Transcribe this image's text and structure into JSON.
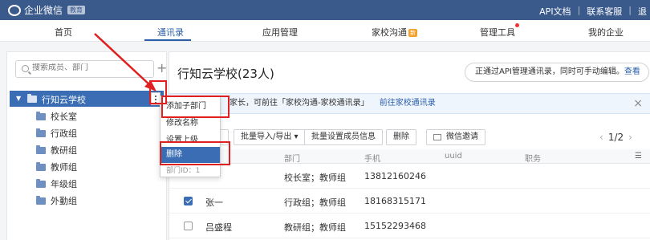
{
  "topbar": {
    "logo_text": "企业微信",
    "logo_badge": "教育",
    "links": [
      "API文档",
      "联系客服",
      "退"
    ]
  },
  "nav": {
    "items": [
      "首页",
      "通讯录",
      "应用管理",
      "家校沟通",
      "管理工具",
      "我的企业"
    ],
    "active": "通讯录",
    "new_badge": "新"
  },
  "sidebar": {
    "search_placeholder": "搜索成员、部门",
    "add_label": "+",
    "root": "行知云学校",
    "children": [
      "校长室",
      "行政组",
      "教研组",
      "教师组",
      "年级组",
      "外勤组"
    ]
  },
  "context_menu": {
    "items": [
      "添加子部门",
      "修改名称",
      "设置上级",
      "删除"
    ],
    "dept_id": "部门ID：1",
    "highlighted": "删除"
  },
  "main": {
    "title": "行知云学校(23人)",
    "api_note": "正通过API管理通讯录，同时可手动编辑。",
    "api_link": "查看",
    "info_text": "家长，可前往「家校沟通-家校通讯录」",
    "info_link": "前往家校通讯录",
    "info_close": "×",
    "toolbar": {
      "import_export": "批量导入/导出 ▾",
      "bulk_set": "批量设置成员信息",
      "delete": "删除",
      "wechat_invite": "微信邀请"
    },
    "pager": {
      "prev": "‹",
      "page": "1/2",
      "next": "›"
    },
    "columns": [
      "部门",
      "手机",
      "uuid",
      "职务"
    ],
    "rows": [
      {
        "name": "",
        "dept": "校长室；教师组",
        "phone": "13812160246",
        "checked": false
      },
      {
        "name": "张一",
        "dept": "行政组；教师组",
        "phone": "18168315171",
        "checked": true
      },
      {
        "name": "吕盛程",
        "dept": "教研组；教师组",
        "phone": "15152293468",
        "checked": false
      }
    ]
  },
  "colors": {
    "topbar": "#3a5a8c",
    "accent": "#3a6db3",
    "annotation": "#e02020"
  }
}
